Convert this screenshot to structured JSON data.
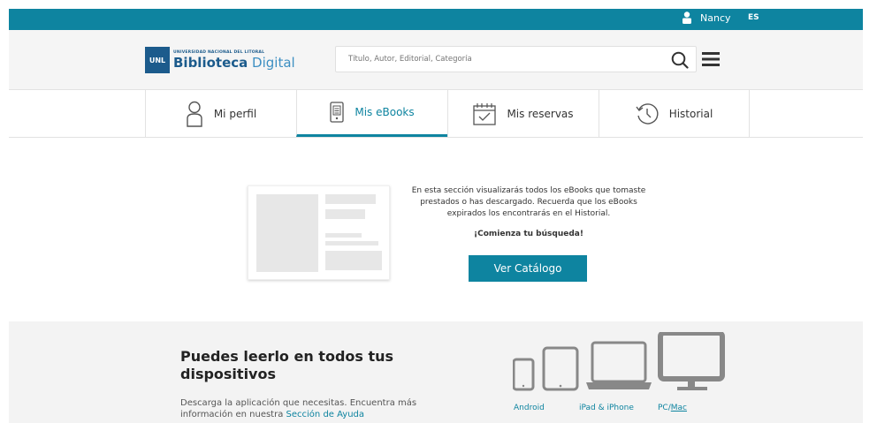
{
  "topbar": {
    "user_name": "Nancy",
    "language": "ES"
  },
  "logo": {
    "badge": "UNL",
    "subtitle": "UNIVERSIDAD NACIONAL DEL LITORAL",
    "name_bold": "Biblioteca",
    "name_light": "Digital"
  },
  "search": {
    "placeholder": "Título, Autor, Editorial, Categoría"
  },
  "tabs": [
    {
      "label": "Mi perfil",
      "icon": "user-icon"
    },
    {
      "label": "Mis eBooks",
      "icon": "ebook-icon",
      "active": true
    },
    {
      "label": "Mis reservas",
      "icon": "calendar-icon"
    },
    {
      "label": "Historial",
      "icon": "history-icon"
    }
  ],
  "empty_state": {
    "message": "En esta sección visualizarás todos los eBooks que tomaste prestados o has descargado. Recuerda que los eBooks expirados los encontrarás en el Historial.",
    "cta": "¡Comienza tu búsqueda!",
    "button": "Ver Catálogo"
  },
  "devices": {
    "title": "Puedes leerlo en todos tus dispositivos",
    "description_prefix": "Descarga la aplicación que necesitas. Encuentra más información en nuestra ",
    "help_link": "Sección de Ayuda",
    "labels": {
      "android": "Android",
      "ipad_iphone": "iPad & iPhone",
      "pc": "PC/",
      "mac": "Mac"
    }
  },
  "colors": {
    "accent": "#0e84a0",
    "brand": "#1c5b8c"
  }
}
